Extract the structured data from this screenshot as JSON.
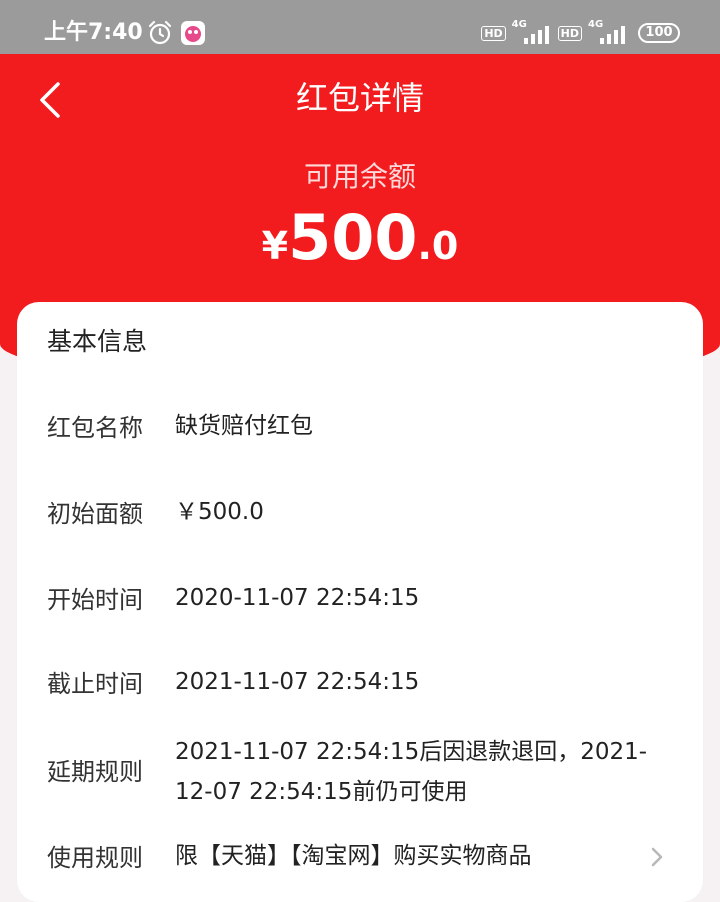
{
  "status_bar": {
    "time": "上午7:40",
    "hd1": "HD",
    "net1": "4G",
    "hd2": "HD",
    "net2": "4G",
    "battery": "100"
  },
  "nav": {
    "title": "红包详情"
  },
  "balance": {
    "label": "可用余额",
    "currency": "¥",
    "integer": "500",
    "decimal": ".0"
  },
  "info": {
    "section_title": "基本信息",
    "rows": [
      {
        "key": "红包名称",
        "value": "缺货赔付红包"
      },
      {
        "key": "初始面额",
        "value": "￥500.0"
      },
      {
        "key": "开始时间",
        "value": "2020-11-07 22:54:15"
      },
      {
        "key": "截止时间",
        "value": "2021-11-07 22:54:15"
      },
      {
        "key": "延期规则",
        "value": "2021-11-07 22:54:15后因退款退回，2021-12-07 22:54:15前仍可使用"
      },
      {
        "key": "使用规则",
        "value": "限【天猫】【淘宝网】购买实物商品"
      }
    ]
  },
  "colors": {
    "header_red": "#f21b1e",
    "status_gray": "#9b9b9b"
  },
  "icons": [
    "alarm-icon",
    "app-icon",
    "back-chevron-icon",
    "chevron-right-icon"
  ]
}
